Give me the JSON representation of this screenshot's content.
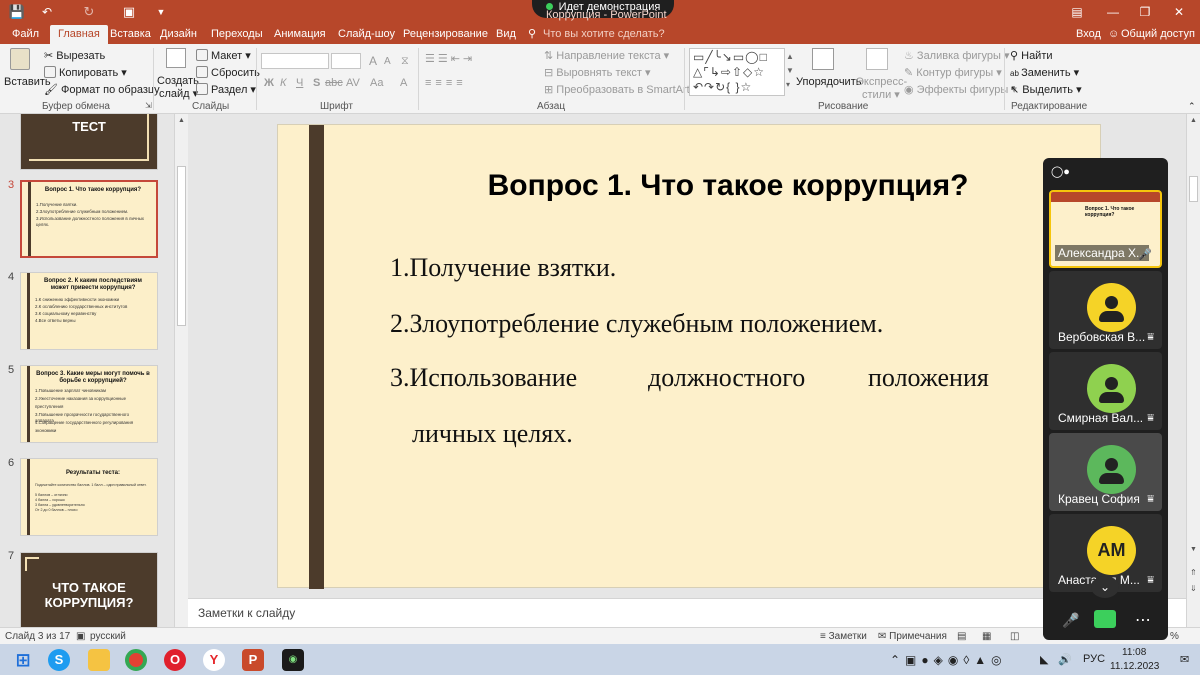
{
  "window": {
    "demo_label": "Идет демонстрация",
    "title": "Коррупция - PowerPoint",
    "signin": "Вход",
    "share": "Общий доступ"
  },
  "tabs": [
    "Файл",
    "Главная",
    "Вставка",
    "Дизайн",
    "Переходы",
    "Анимация",
    "Слайд-шоу",
    "Рецензирование",
    "Вид"
  ],
  "tell_me": "Что вы хотите сделать?",
  "ribbon": {
    "clipboard": {
      "paste": "Вставить",
      "cut": "Вырезать",
      "copy": "Копировать",
      "format_painter": "Формат по образцу",
      "label": "Буфер обмена"
    },
    "slides": {
      "new_slide_1": "Создать",
      "new_slide_2": "слайд",
      "layout": "Макет",
      "reset": "Сбросить",
      "section": "Раздел",
      "label": "Слайды"
    },
    "font": {
      "bold": "Ж",
      "italic": "К",
      "underline": "Ч",
      "shadow": "S",
      "strike": "abc",
      "spacing": "AV",
      "case": "Aa",
      "grow": "A",
      "shrink": "A",
      "color": "A",
      "label": "Шрифт"
    },
    "paragraph": {
      "text_direction": "Направление текста",
      "align_text": "Выровнять текст",
      "smartart": "Преобразовать в SmartArt",
      "label": "Абзац"
    },
    "drawing": {
      "arrange": "Упорядочить",
      "quick_styles_1": "Экспресс-",
      "quick_styles_2": "стили",
      "fill": "Заливка фигуры",
      "outline": "Контур фигуры",
      "effects": "Эффекты фигуры",
      "label": "Рисование"
    },
    "editing": {
      "find": "Найти",
      "replace": "Заменить",
      "select": "Выделить",
      "label": "Редактирование"
    }
  },
  "thumbnails": [
    {
      "num": "",
      "dark": true,
      "title": "ТЕСТ"
    },
    {
      "num": "3",
      "title": "Вопрос 1. Что такое коррупция?",
      "lines": [
        "1.Получение взятки.",
        "2.Злоупотребление служебным положением.",
        "3.Использование должностного положения в личных целях."
      ]
    },
    {
      "num": "4",
      "title": "Вопрос 2. К каким последствиям может привести коррупция?",
      "lines": [
        "1.К снижению эффективности экономики",
        "2.К ослаблению государственных институтов",
        "3.К социальному неравенству",
        "4.Все ответы верны"
      ]
    },
    {
      "num": "5",
      "title": "Вопрос 3. Какие меры могут помочь в борьбе с коррупцией?",
      "lines": [
        "1.Повышение зарплат чиновникам",
        "2.Ужесточение наказания за коррупционные",
        "преступления",
        "3.Повышение прозрачности государственного аппарата",
        "4.Сокращение государственного регулирования",
        "экономики"
      ]
    },
    {
      "num": "6",
      "title": "Результаты теста:",
      "lines": [
        "Подсчитайте количество баллов. 1 балл – один правильный ответ.",
        "5 баллов – отлично",
        "4 балла – хорошо",
        "3 балла – удовлетворительно",
        "От 2 до 0 баллов – плохо"
      ]
    },
    {
      "num": "7",
      "dark": true,
      "title": "ЧТО ТАКОЕ КОРРУПЦИЯ?"
    }
  ],
  "slide": {
    "title": "Вопрос 1. Что такое коррупция?",
    "line1": "1.Получение взятки.",
    "line2": "2.Злоупотребление служебным положением.",
    "line3_a": "3.Использование",
    "line3_b": "должностного",
    "line3_c": "положения",
    "line3_d": "в",
    "line4": "личных целях."
  },
  "notes_placeholder": "Заметки к слайду",
  "status": {
    "slide_of": "Слайд 3 из 17",
    "language": "русский",
    "notes": "Заметки",
    "comments": "Примечания",
    "zoom": "%"
  },
  "meeting": {
    "participants": [
      {
        "name": "Александра Х...",
        "screen": true
      },
      {
        "name": "Вербовская В...",
        "color": "#f5d327"
      },
      {
        "name": "Смирная Вал...",
        "color": "#8fd14f"
      },
      {
        "name": "Кравец София",
        "color": "#5cb85c"
      },
      {
        "name": "Анастасия М...",
        "color": "#f5d327",
        "initials": "АМ"
      }
    ]
  },
  "taskbar": {
    "lang": "РУС",
    "time": "11:08",
    "date": "11.12.2023"
  },
  "colors": {
    "accent": "#b7472a",
    "slide_bg": "#fdf0cb",
    "slide_bar": "#4c3b2b"
  }
}
